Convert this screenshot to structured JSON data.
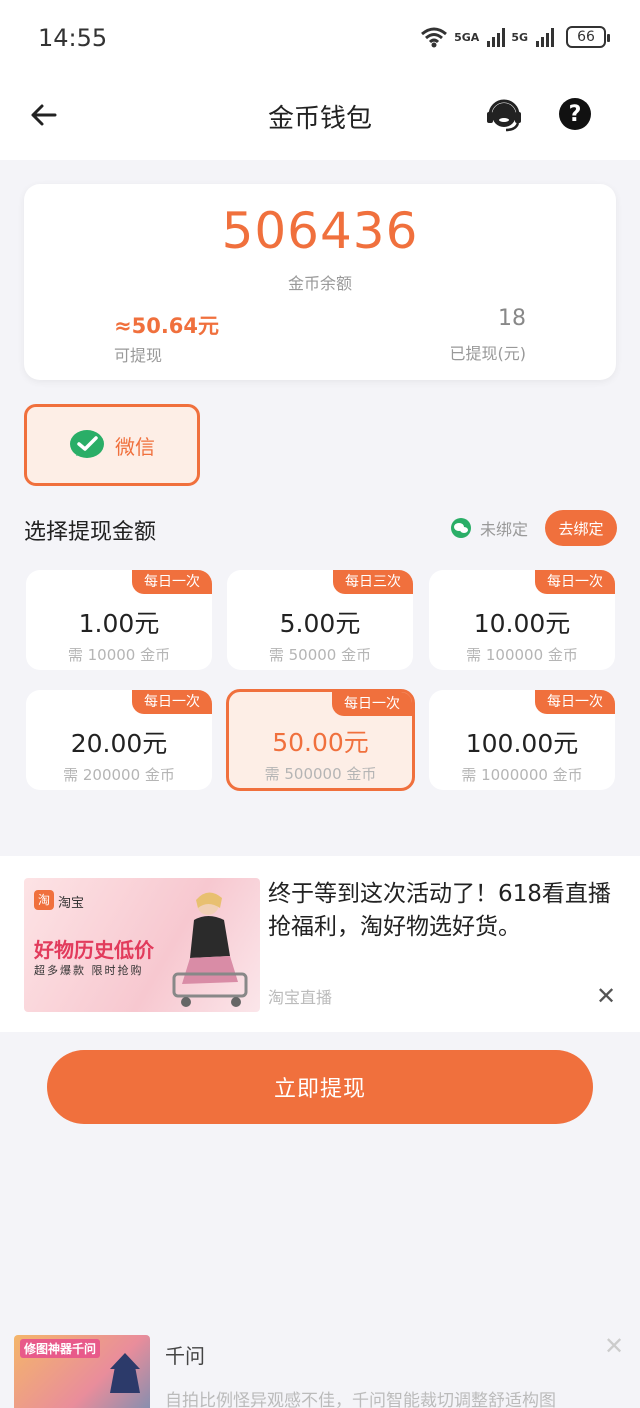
{
  "status_bar": {
    "time": "14:55",
    "net1": "5GA",
    "net2": "5G",
    "battery": "66"
  },
  "header": {
    "title": "金币钱包"
  },
  "balance": {
    "coins": "506436",
    "coins_label": "金币余额",
    "withdrawable_value": "≈50.64元",
    "withdrawable_label": "可提现",
    "withdrawn_value": "18",
    "withdrawn_label": "已提现(元)"
  },
  "payment": {
    "method_label": "微信",
    "accent_color": "#f0703d",
    "wechat_color": "#2aae67"
  },
  "section": {
    "title": "选择提现金额",
    "bind_status": "未绑定",
    "bind_button": "去绑定"
  },
  "options": [
    {
      "tag": "每日一次",
      "amount": "1.00元",
      "need": "需 10000 金币"
    },
    {
      "tag": "每日三次",
      "amount": "5.00元",
      "need": "需 50000 金币"
    },
    {
      "tag": "每日一次",
      "amount": "10.00元",
      "need": "需 100000 金币"
    },
    {
      "tag": "每日一次",
      "amount": "20.00元",
      "need": "需 200000 金币"
    },
    {
      "tag": "每日一次",
      "amount": "50.00元",
      "need": "需 500000 金币"
    },
    {
      "tag": "每日一次",
      "amount": "100.00元",
      "need": "需 1000000 金币"
    }
  ],
  "ad1": {
    "brand": "淘宝",
    "headline": "好物历史低价",
    "subline": "超多爆款 限时抢购",
    "text": "终于等到这次活动了！618看直播抢福利，淘好物选好货。",
    "source": "淘宝直播",
    "close": "✕"
  },
  "withdraw_button": "立即提现",
  "ad2": {
    "image_text": "修图神器千问",
    "title": "千问",
    "desc": "自拍比例怪异观感不佳，千问智能裁切调整舒适构图",
    "close": "✕"
  }
}
